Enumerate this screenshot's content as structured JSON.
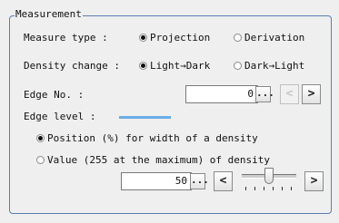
{
  "group_title": "Measurement",
  "measure_type": {
    "label": "Measure type :",
    "options": [
      "Projection",
      "Derivation"
    ],
    "selected": 0
  },
  "density_change": {
    "label": "Density change :",
    "options": [
      "Light→Dark",
      "Dark→Light"
    ],
    "selected": 0
  },
  "edge_no": {
    "label": "Edge No. :",
    "value": "0",
    "browse_label": "...",
    "prev_label": "<",
    "next_label": ">"
  },
  "edge_level": {
    "label": "Edge level :",
    "bar_color": "#6aaee8",
    "options": [
      "Position (%) for width of a density",
      "Value (255 at the maximum) of density"
    ],
    "selected": 0,
    "value": "50",
    "browse_label": "...",
    "prev_label": "<",
    "next_label": ">",
    "slider_level": 0.5
  }
}
